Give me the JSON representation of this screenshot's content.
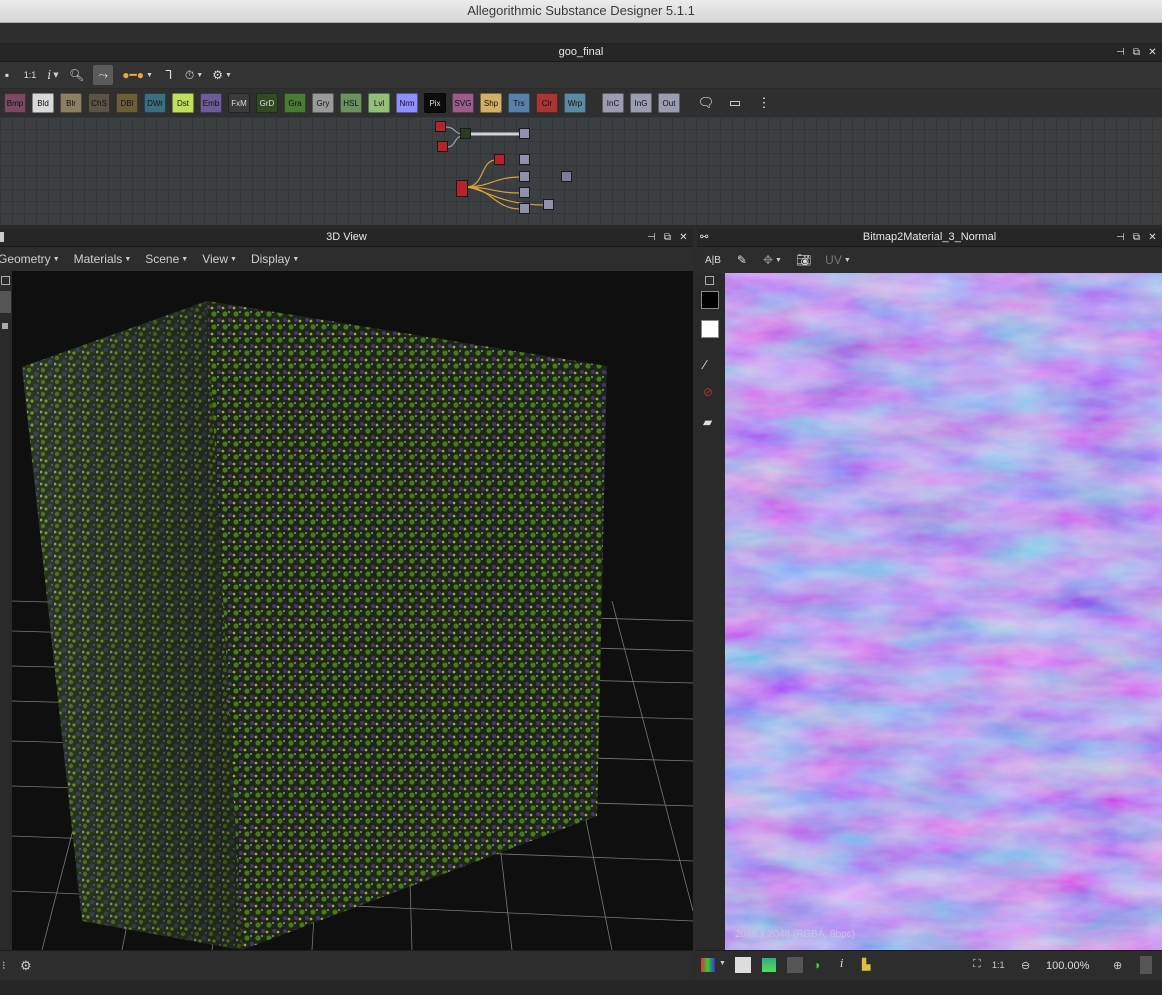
{
  "window": {
    "title": "Allegorithmic Substance Designer 5.1.1"
  },
  "graph_panel": {
    "title": "goo_final",
    "toolbar": {
      "zoom_label": "1:1",
      "info_icon": "i"
    },
    "atomic_nodes": [
      {
        "label": "Bmp",
        "color": "#7a4a64"
      },
      {
        "label": "Bld",
        "color": "#d9d9d9"
      },
      {
        "label": "Blr",
        "color": "#8c7f63"
      },
      {
        "label": "ChS",
        "color": "#5b5347"
      },
      {
        "label": "DBl",
        "color": "#6a5f3a"
      },
      {
        "label": "DWr",
        "color": "#3d6e80"
      },
      {
        "label": "Dst",
        "color": "#bfe05c"
      },
      {
        "label": "Emb",
        "color": "#6e5c98"
      },
      {
        "label": "FxM",
        "color": "#3a3a3a"
      },
      {
        "label": "GrD",
        "color": "#2f4a25"
      },
      {
        "label": "Gra",
        "color": "#4a7a34"
      },
      {
        "label": "Gry",
        "color": "#9a9a9a"
      },
      {
        "label": "HSL",
        "color": "#6c9060"
      },
      {
        "label": "Lvl",
        "color": "#92c07a"
      },
      {
        "label": "Nrm",
        "color": "#8f8fff"
      },
      {
        "label": "Pix",
        "color": "#0c0c0c"
      },
      {
        "label": "SVG",
        "color": "#9a5e8c"
      },
      {
        "label": "Shp",
        "color": "#d2b068"
      },
      {
        "label": "Trs",
        "color": "#5a7fa8"
      },
      {
        "label": "Clr",
        "color": "#a83636"
      },
      {
        "label": "Wrp",
        "color": "#5c8aa0"
      },
      {
        "label": "InC",
        "color": "#9c9cb0"
      },
      {
        "label": "InG",
        "color": "#9c9cb0"
      },
      {
        "label": "Out",
        "color": "#9c9cb0"
      }
    ],
    "palette_tools": [
      "comment-icon",
      "frame-icon",
      "pin-icon"
    ]
  },
  "view3d": {
    "title": "3D View",
    "menus": [
      "Geometry",
      "Materials",
      "Scene",
      "View",
      "Display"
    ]
  },
  "view2d": {
    "title": "Bitmap2Material_3_Normal",
    "uv_label": "UV",
    "image_info": "2048 x 2048 (RGBA, 8bpc)",
    "zoom_ratio": "1:1",
    "zoom_percent": "100.00%"
  },
  "colors": {
    "panel_bg": "#2d2d2d",
    "graph_bg": "#3c3f41",
    "viewport_bg": "#0f0f0f",
    "normal_map_base": "#8a7cf0"
  }
}
